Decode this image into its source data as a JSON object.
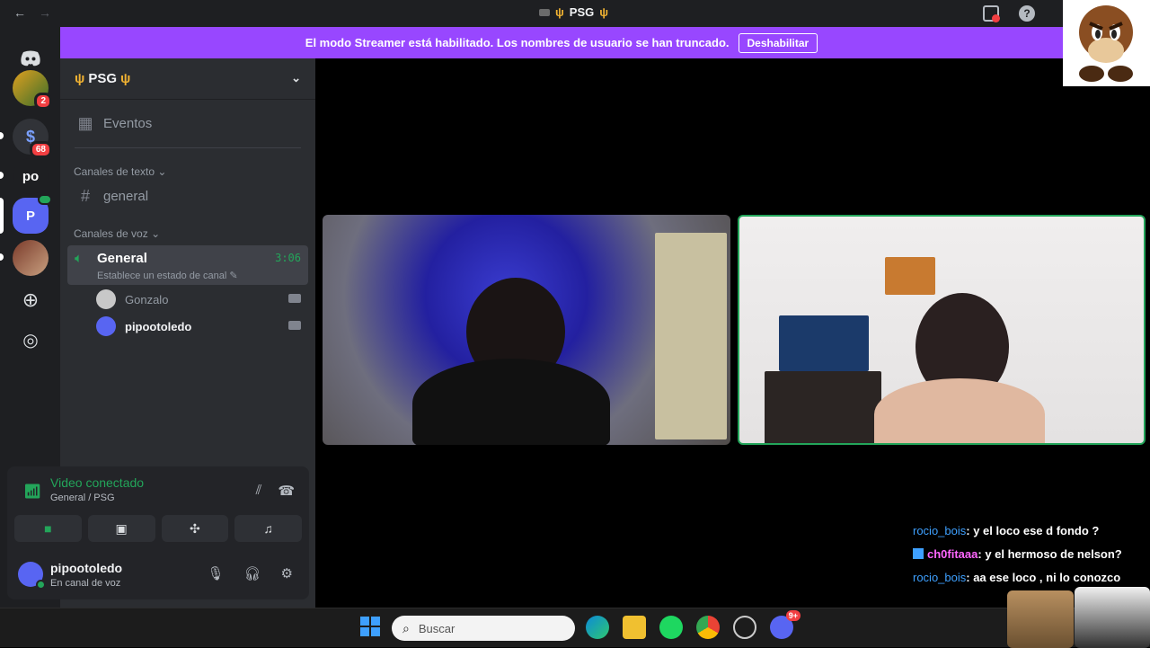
{
  "window": {
    "back_icon": "←",
    "forward_icon": "→",
    "title": "PSG"
  },
  "banner": {
    "text": "El modo Streamer está habilitado. Los nombres de usuario se han truncado.",
    "button": "Deshabilitar"
  },
  "rail": {
    "badges": [
      "2",
      "68"
    ],
    "text_server": "po",
    "active_server": "P"
  },
  "sidebar": {
    "server_name": "PSG",
    "events_label": "Eventos",
    "text_category": "Canales de texto",
    "text_channels": [
      "general"
    ],
    "voice_category": "Canales de voz",
    "voice_channel": {
      "name": "General",
      "status": "Establece un estado de canal",
      "time": "3:06"
    },
    "voice_users": [
      {
        "name": "Gonzalo"
      },
      {
        "name": "pipootoledo"
      }
    ]
  },
  "voice_panel": {
    "title": "Video conectado",
    "subtitle": "General / PSG"
  },
  "user_panel": {
    "username": "pipootoledo",
    "status": "En canal de voz"
  },
  "chat": [
    {
      "user": "rocio_bois",
      "message": ": y el loco ese d fondo ?"
    },
    {
      "user": "ch0fitaaa",
      "message": ": y el hermoso de nelson?"
    },
    {
      "user": "rocio_bois",
      "message": ": aa ese loco , ni lo conozco"
    }
  ],
  "taskbar": {
    "search_placeholder": "Buscar",
    "discord_badge": "9+"
  },
  "colors": {
    "accent": "#5865f2",
    "banner": "#9847ff",
    "online": "#23a55a",
    "danger": "#f23f42"
  }
}
